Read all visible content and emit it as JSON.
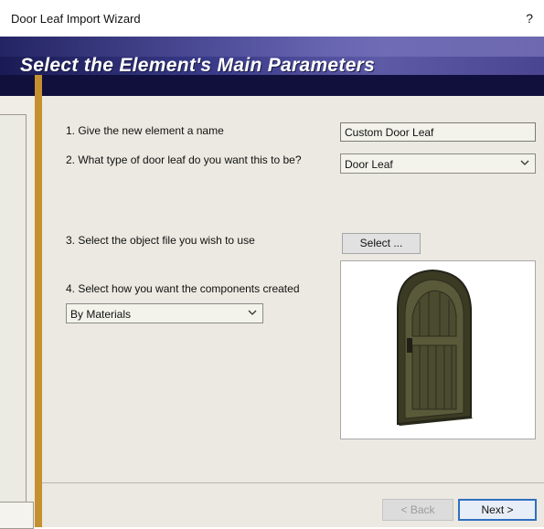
{
  "window": {
    "title": "Door Leaf Import Wizard",
    "help_label": "?"
  },
  "banner": {
    "title": "Select the Element's Main Parameters"
  },
  "steps": {
    "step1": "1. Give the new element a name",
    "step2": "2. What type of door leaf do you want this to be?",
    "step3": "3. Select the object file you wish to use",
    "step4": "4. Select how you want the components created"
  },
  "fields": {
    "name_value": "Custom Door Leaf",
    "type_value": "Door Leaf",
    "components_value": "By Materials"
  },
  "buttons": {
    "select_label": "Select ...",
    "back_label": "< Back",
    "next_label": "Next >"
  },
  "icons": {
    "dropdown": "chevron-down-icon",
    "preview": "door-leaf-preview"
  },
  "colors": {
    "banner": "#2a2a6e",
    "accent_bar": "#c5902f",
    "panel": "#ebe9e1",
    "door": "#4a4a2e"
  }
}
